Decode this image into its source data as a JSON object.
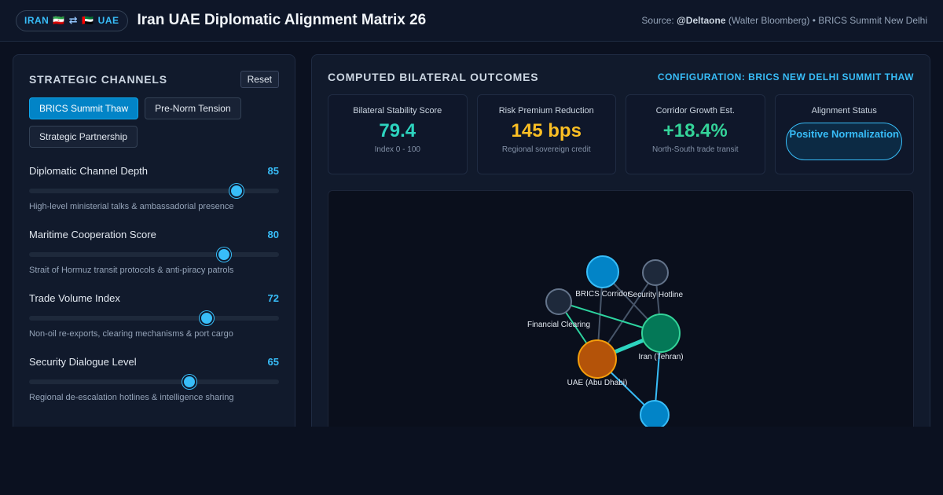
{
  "header": {
    "badge_left": "IRAN",
    "badge_flag_iran": "🇮🇷",
    "badge_swap": "⇄",
    "badge_flag_uae": "🇦🇪",
    "badge_right": "UAE",
    "title": "Iran UAE Diplomatic Alignment Matrix 26",
    "source_prefix": "Source:",
    "source_handle": "@Deltaone",
    "source_rest": "(Walter Bloomberg) • BRICS Summit New Delhi"
  },
  "left": {
    "title": "STRATEGIC CHANNELS",
    "reset_label": "Reset",
    "presets": [
      {
        "label": "BRICS Summit Thaw",
        "active": true
      },
      {
        "label": "Pre-Norm Tension",
        "active": false
      },
      {
        "label": "Strategic Partnership",
        "active": false
      }
    ],
    "sliders": [
      {
        "label": "Diplomatic Channel Depth",
        "value": "85",
        "fraction": 0.83,
        "desc": "High-level ministerial talks & ambassadorial presence"
      },
      {
        "label": "Maritime Cooperation Score",
        "value": "80",
        "fraction": 0.78,
        "desc": "Strait of Hormuz transit protocols & anti-piracy patrols"
      },
      {
        "label": "Trade Volume Index",
        "value": "72",
        "fraction": 0.71,
        "desc": "Non-oil re-exports, clearing mechanisms & port cargo"
      },
      {
        "label": "Security Dialogue Level",
        "value": "65",
        "fraction": 0.64,
        "desc": "Regional de-escalation hotlines & intelligence sharing"
      }
    ]
  },
  "right": {
    "title": "COMPUTED BILATERAL OUTCOMES",
    "config_label": "CONFIGURATION: BRICS NEW DELHI SUMMIT THAW",
    "metrics": {
      "stability": {
        "label": "Bilateral Stability Score",
        "value": "79.4",
        "sub": "Index 0 - 100",
        "color": "#2dd4bf"
      },
      "risk": {
        "label": "Risk Premium Reduction",
        "value": "145 bps",
        "sub": "Regional sovereign credit",
        "color": "#fbbf24"
      },
      "corridor": {
        "label": "Corridor Growth Est.",
        "value": "+18.4%",
        "sub": "North-South trade transit",
        "color": "#34d399"
      },
      "alignment": {
        "label": "Alignment Status",
        "value": "Positive Normalization"
      }
    },
    "graph": {
      "nodes": {
        "brics": {
          "label": "BRICS Corridor",
          "color": "#0284c7"
        },
        "hotline": {
          "label": "Security Hotline",
          "color": "#1e293b"
        },
        "clearing": {
          "label": "Financial Clearing",
          "color": "#1e293b"
        },
        "iran": {
          "label": "Iran (Tehran)",
          "color": "#047857"
        },
        "uae": {
          "label": "UAE (Abu Dhabi)",
          "color": "#b45309"
        },
        "port": {
          "label": "",
          "color": "#0284c7"
        }
      }
    }
  }
}
